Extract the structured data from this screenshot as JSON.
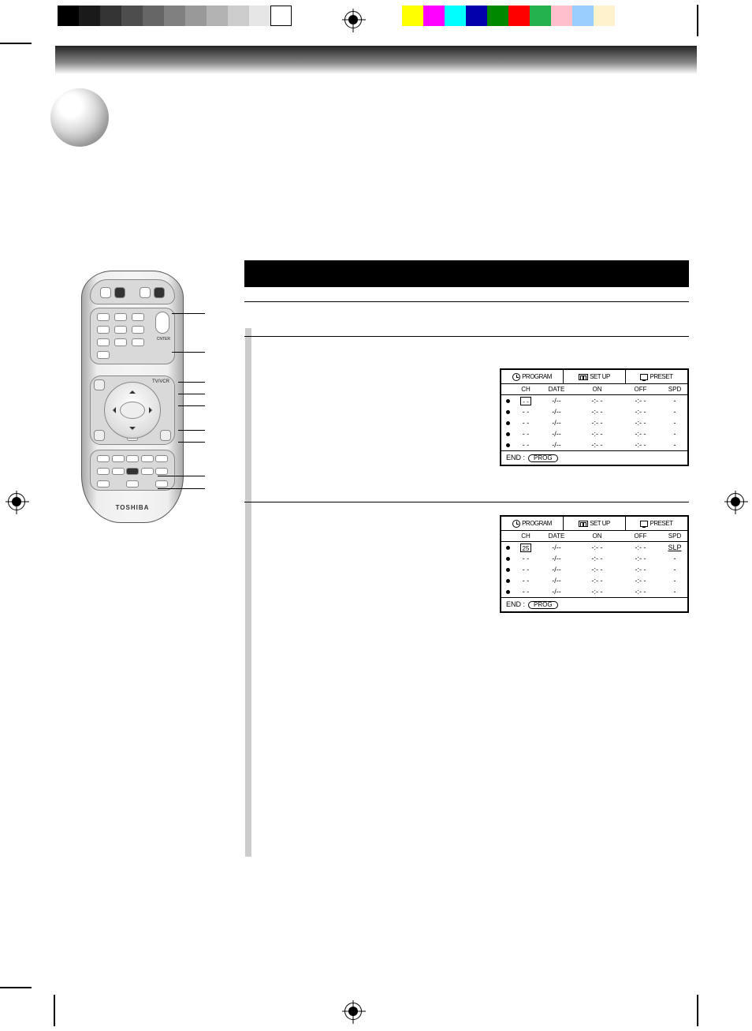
{
  "remote": {
    "brand": "TOSHIBA",
    "tvvcr_label": "TV/VCR",
    "center_label": "CNTER"
  },
  "osd_common": {
    "tabs": [
      "PROGRAM",
      "SET  UP",
      "PRESET"
    ],
    "headers": [
      "CH",
      "DATE",
      "ON",
      "OFF",
      "SPD"
    ],
    "end_label": "END :",
    "end_button": "PROG"
  },
  "osd1": {
    "rows": [
      {
        "ch": "- -",
        "date": "-/--",
        "on": "-:- -",
        "off": "-:- -",
        "spd": "-",
        "boxed": true
      },
      {
        "ch": "- -",
        "date": "-/--",
        "on": "-:- -",
        "off": "-:- -",
        "spd": "-"
      },
      {
        "ch": "- -",
        "date": "-/--",
        "on": "-:- -",
        "off": "-:- -",
        "spd": "-"
      },
      {
        "ch": "- -",
        "date": "-/--",
        "on": "-:- -",
        "off": "-:- -",
        "spd": "-"
      },
      {
        "ch": "- -",
        "date": "-/--",
        "on": "-:- -",
        "off": "-:- -",
        "spd": "-"
      }
    ]
  },
  "osd2": {
    "rows": [
      {
        "ch": "25",
        "date": "-/--",
        "on": "-:- -",
        "off": "-:- -",
        "spd": "SLP",
        "boxed": true,
        "spd_underline": true
      },
      {
        "ch": "- -",
        "date": "-/--",
        "on": "-:- -",
        "off": "-:- -",
        "spd": "-"
      },
      {
        "ch": "- -",
        "date": "-/--",
        "on": "-:- -",
        "off": "-:- -",
        "spd": "-"
      },
      {
        "ch": "- -",
        "date": "-/--",
        "on": "-:- -",
        "off": "-:- -",
        "spd": "-"
      },
      {
        "ch": "- -",
        "date": "-/--",
        "on": "-:- -",
        "off": "-:- -",
        "spd": "-"
      }
    ]
  },
  "colorbars": {
    "left": [
      "#000000",
      "#1a1a1a",
      "#333333",
      "#4d4d4d",
      "#666666",
      "#808080",
      "#999999",
      "#b3b3b3",
      "#cccccc",
      "#e6e6e6",
      "#ffffff"
    ],
    "right": [
      "#ffff00",
      "#ff00ff",
      "#00ffff",
      "#0000aa",
      "#008800",
      "#ff0000",
      "#23b14d",
      "#ffc0cb",
      "#99ccff",
      "#fff2cc"
    ]
  }
}
